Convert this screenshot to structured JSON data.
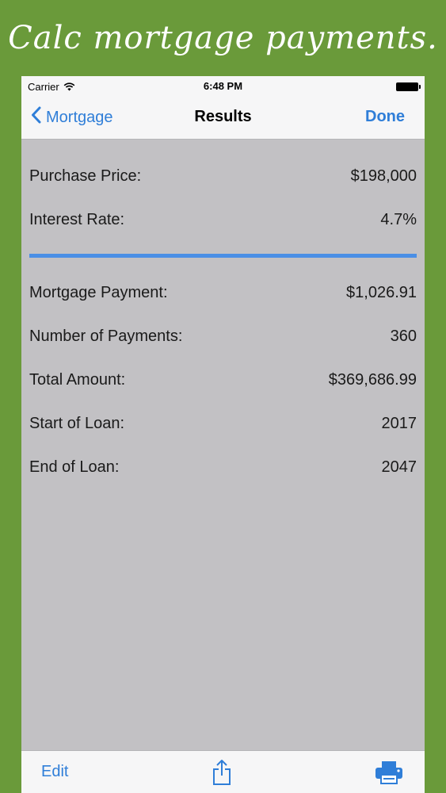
{
  "banner": {
    "text": "Calc mortgage payments."
  },
  "status_bar": {
    "carrier": "Carrier",
    "time": "6:48 PM"
  },
  "nav": {
    "back_label": "Mortgage",
    "title": "Results",
    "done_label": "Done"
  },
  "inputs": [
    {
      "label": "Purchase Price:",
      "value": "$198,000"
    },
    {
      "label": "Interest Rate:",
      "value": "4.7%"
    }
  ],
  "results": [
    {
      "label": "Mortgage Payment:",
      "value": "$1,026.91"
    },
    {
      "label": "Number of Payments:",
      "value": "360"
    },
    {
      "label": "Total Amount:",
      "value": "$369,686.99"
    },
    {
      "label": "Start of Loan:",
      "value": "2017"
    },
    {
      "label": "End of Loan:",
      "value": "2047"
    }
  ],
  "toolbar": {
    "edit_label": "Edit"
  },
  "icons": {
    "back": "chevron-left-icon",
    "share": "share-icon",
    "print": "printer-icon",
    "wifi": "wifi-icon",
    "battery": "battery-icon"
  },
  "colors": {
    "accent": "#2f7ed8",
    "divider": "#4a8fe6",
    "background": "#6a9a3a",
    "panel": "#c2c1c4"
  }
}
